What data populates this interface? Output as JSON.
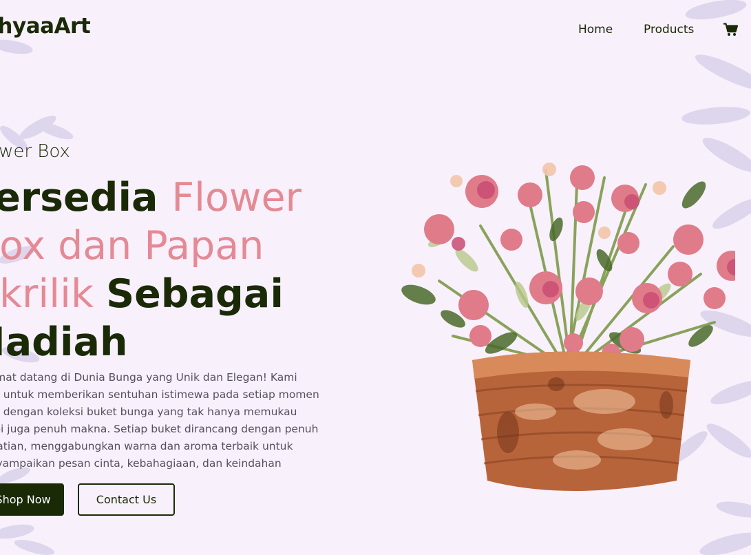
{
  "brand": {
    "logo_text": "ahyaaArt"
  },
  "nav": {
    "items": [
      {
        "label": "Home"
      },
      {
        "label": "Products"
      }
    ],
    "cart_icon": "cart-icon"
  },
  "hero": {
    "eyebrow": "Flower Box",
    "headline": {
      "line1_dark": "Tersedia ",
      "line1_pink": "Flower",
      "line2_pink": "Box dan Papan",
      "line3_pink": "Akrilik ",
      "line3_dark": "Sebagai",
      "line4_dark": "Hadiah"
    },
    "description": "Selamat datang di Dunia Bunga yang Unik dan Elegan! Kami hadir untuk memberikan sentuhan istimewa pada setiap momen Anda dengan koleksi buket bunga yang tak hanya memukau tetapi juga penuh makna. Setiap buket dirancang dengan penuh perhatian, menggabungkan warna dan aroma terbaik untuk menyampaikan pesan cinta, kebahagiaan, dan keindahan",
    "buttons": {
      "shop": "Shop Now",
      "contact": "Contact Us"
    },
    "image_icon": "flower-basket-illustration"
  },
  "colors": {
    "background": "#f8f0fb",
    "primary_dark": "#1a2a06",
    "accent_pink": "#e48a94",
    "body_text": "#555060"
  }
}
